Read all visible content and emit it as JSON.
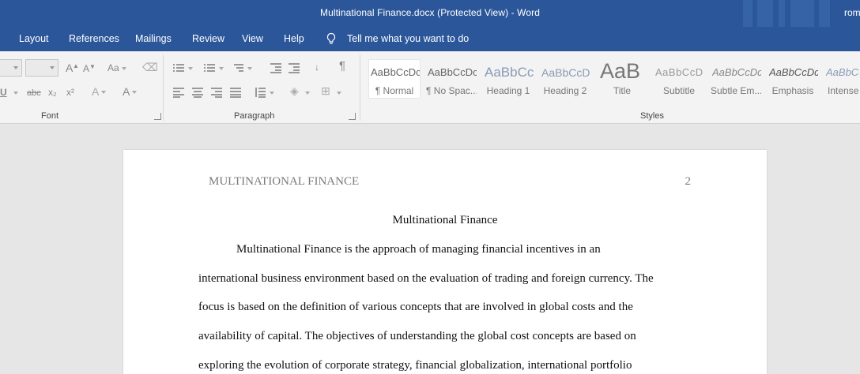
{
  "window": {
    "title": "Multinational Finance.docx (Protected View)  -  Word",
    "user_fragment": "rom"
  },
  "menu": {
    "items": [
      "Layout",
      "References",
      "Mailings",
      "Review",
      "View",
      "Help"
    ],
    "tell_me": "Tell me what you want to do"
  },
  "ribbon": {
    "groups": {
      "font": "Font",
      "paragraph": "Paragraph",
      "styles": "Styles"
    },
    "font": {
      "grow_font": "A",
      "shrink_font": "A",
      "change_case": "Aa",
      "underline": "U",
      "strikethrough": "abc",
      "subscript": "x₂",
      "superscript": "x²",
      "text_effects": "A",
      "font_color": "A"
    },
    "styles": [
      {
        "sample": "AaBbCcDc",
        "name": "¶ Normal"
      },
      {
        "sample": "AaBbCcDc",
        "name": "¶ No Spac..."
      },
      {
        "sample": "AaBbCc",
        "name": "Heading 1"
      },
      {
        "sample": "AaBbCcD",
        "name": "Heading 2"
      },
      {
        "sample": "AaB",
        "name": "Title"
      },
      {
        "sample": "AaBbCcD",
        "name": "Subtitle"
      },
      {
        "sample": "AaBbCcDc",
        "name": "Subtle Em..."
      },
      {
        "sample": "AaBbCcDc",
        "name": "Emphasis"
      },
      {
        "sample": "AaBbCcDc",
        "name": "Intense"
      }
    ]
  },
  "document": {
    "header_text": "MULTINATIONAL FINANCE",
    "page_number": "2",
    "title": "Multinational Finance",
    "lines": [
      "Multinational Finance is the approach of managing financial incentives in an",
      "international business environment based on the evaluation of trading and foreign currency. The",
      "focus is based on the definition of various concepts that are involved in global costs and the",
      "availability of capital. The objectives of understanding the global cost concepts are based on",
      "exploring the evolution of corporate strategy, financial globalization, international portfolio"
    ]
  },
  "colors": {
    "titlebar": "#2b579a",
    "ribbon": "#f3f3f3",
    "workspace": "#e6e6e6",
    "page": "#ffffff"
  }
}
